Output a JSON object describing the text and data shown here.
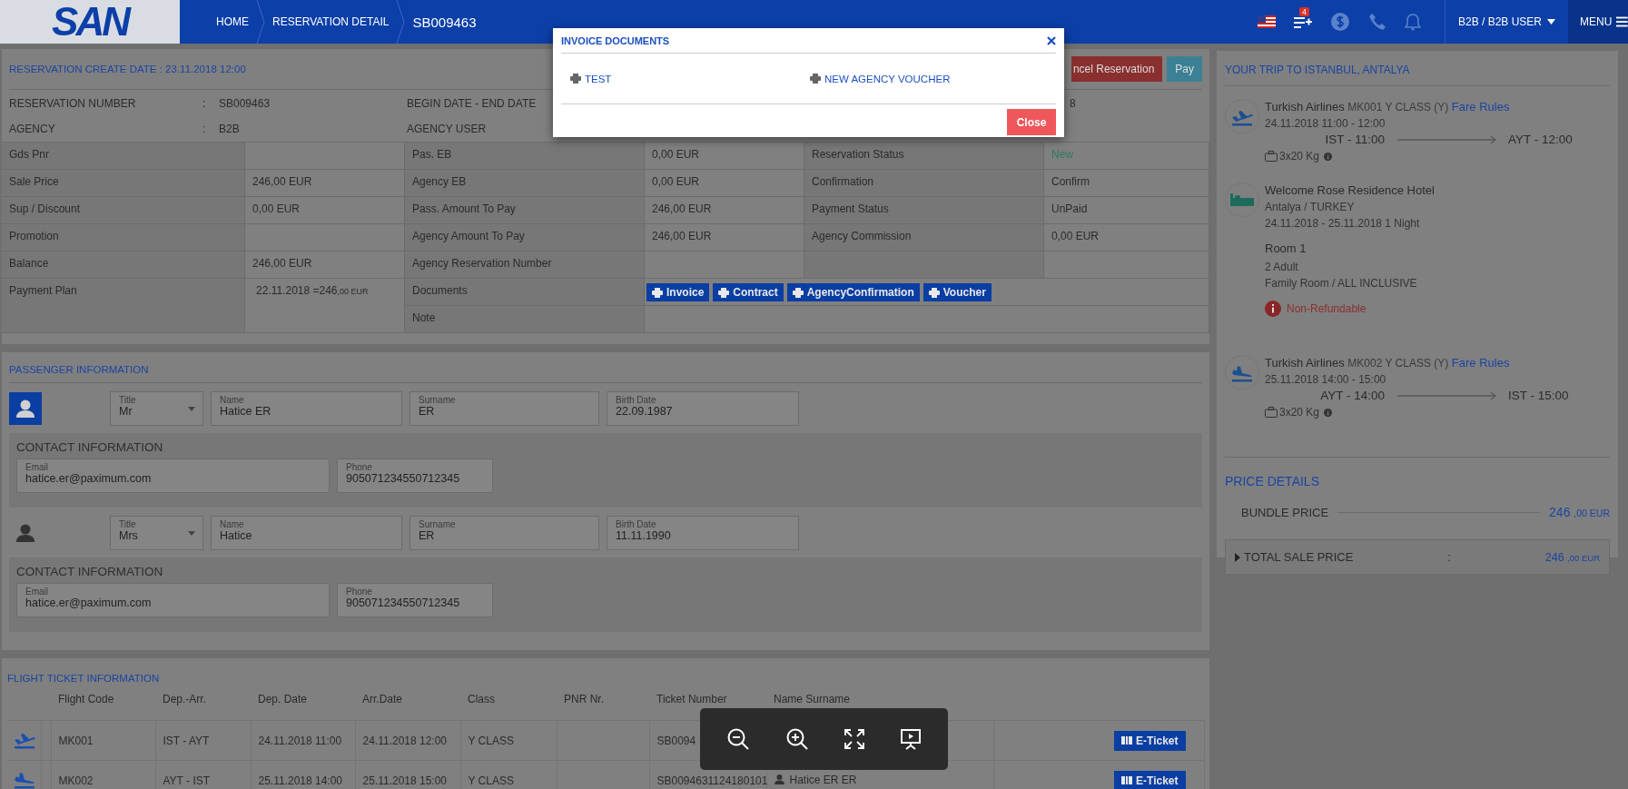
{
  "header": {
    "logo": "SAN",
    "breadcrumb": [
      {
        "label": "HOME",
        "current": false
      },
      {
        "label": "RESERVATION DETAIL",
        "current": false
      },
      {
        "label": "SB009463",
        "current": true
      }
    ],
    "cart_badge": "4",
    "user": "B2B / B2B USER",
    "menu": "MENU"
  },
  "reservation": {
    "title": "RESERVATION CREATE DATE : 23.11.2018 12:00",
    "actions": [
      {
        "label": "ncel Reservation",
        "kind": "danger"
      },
      {
        "label": "Pay",
        "kind": "primary"
      }
    ],
    "info": [
      {
        "label": "RESERVATION NUMBER",
        "separator": ":",
        "value": "SB009463"
      },
      {
        "label": "BEGIN DATE - END DATE",
        "value": "8"
      },
      {
        "label": "AGENCY",
        "separator": ":",
        "value": "B2B"
      },
      {
        "label": "AGENCY USER"
      }
    ],
    "grid": [
      {
        "cells": [
          {
            "kind": "label",
            "text": "Gds Pnr"
          },
          {
            "kind": "value"
          },
          {
            "kind": "label",
            "text": "Pas. EB"
          },
          {
            "kind": "value",
            "text": "0,00 EUR"
          },
          {
            "kind": "label",
            "text": "Reservation Status"
          },
          {
            "kind": "status",
            "text": "New"
          }
        ]
      },
      {
        "cells": [
          {
            "kind": "label",
            "text": "Sale Price"
          },
          {
            "kind": "value",
            "text": "246,00 EUR"
          },
          {
            "kind": "label",
            "text": "Agency EB"
          },
          {
            "kind": "value",
            "text": "0,00 EUR"
          },
          {
            "kind": "label",
            "text": "Confirmation"
          },
          {
            "kind": "value",
            "text": "Confirm"
          }
        ]
      },
      {
        "cells": [
          {
            "kind": "label",
            "text": "Sup / Discount"
          },
          {
            "kind": "value",
            "text": "0,00 EUR"
          },
          {
            "kind": "label",
            "text": "Pass. Amount To Pay"
          },
          {
            "kind": "value",
            "text": "246,00 EUR"
          },
          {
            "kind": "label",
            "text": "Payment Status"
          },
          {
            "kind": "value",
            "text": "UnPaid"
          }
        ]
      },
      {
        "cells": [
          {
            "kind": "label",
            "text": "Promotion"
          },
          {
            "kind": "value"
          },
          {
            "kind": "label",
            "text": "Agency Amount To Pay"
          },
          {
            "kind": "value",
            "text": "246,00 EUR"
          },
          {
            "kind": "label",
            "text": "Agency Commission"
          },
          {
            "kind": "value",
            "text": "0,00 EUR"
          }
        ]
      },
      {
        "cells": [
          {
            "kind": "label",
            "text": "Balance"
          },
          {
            "kind": "value",
            "text": "246,00 EUR"
          },
          {
            "kind": "label",
            "text": "Agency Reservation Number"
          },
          {
            "kind": "value"
          },
          {
            "kind": "label"
          },
          {
            "kind": "value"
          }
        ]
      }
    ],
    "payment_plan": {
      "label": "Payment Plan",
      "date_amount": "22.11.2018 =246",
      "decimals": ",00 EUR"
    },
    "documents": {
      "label": "Documents",
      "buttons": [
        {
          "label": "Invoice"
        },
        {
          "label": "Contract"
        },
        {
          "label": "AgencyConfirmation"
        },
        {
          "label": "Voucher"
        }
      ]
    },
    "note": {
      "label": "Note"
    }
  },
  "passengers": {
    "title": "PASSENGER INFORMATION",
    "items": [
      {
        "lead": true,
        "fields": [
          {
            "kind": "select",
            "label": "Title",
            "value": "Mr"
          },
          {
            "kind": "text",
            "label": "Name",
            "value": "Hatice ER"
          },
          {
            "kind": "text",
            "label": "Surname",
            "value": "ER"
          },
          {
            "kind": "text",
            "label": "Birth Date",
            "value": "22.09.1987"
          }
        ],
        "contact": {
          "title": "CONTACT INFORMATION",
          "fields": [
            {
              "kind": "email",
              "label": "Email",
              "value": "hatice.er@paximum.com"
            },
            {
              "kind": "phone",
              "label": "Phone",
              "value": "905071234550712345"
            }
          ]
        }
      },
      {
        "lead": false,
        "fields": [
          {
            "kind": "select",
            "label": "Title",
            "value": "Mrs"
          },
          {
            "kind": "text",
            "label": "Name",
            "value": "Hatice"
          },
          {
            "kind": "text",
            "label": "Surname",
            "value": "ER"
          },
          {
            "kind": "text",
            "label": "Birth Date",
            "value": "11.11.1990"
          }
        ],
        "contact": {
          "title": "CONTACT INFORMATION",
          "fields": [
            {
              "kind": "email",
              "label": "Email",
              "value": "hatice.er@paximum.com"
            },
            {
              "kind": "phone",
              "label": "Phone",
              "value": "905071234550712345"
            }
          ]
        }
      }
    ]
  },
  "tickets": {
    "title": "FLIGHT TICKET INFORMATION",
    "columns": [
      "Flight Code",
      "Dep.-Arr.",
      "Dep. Date",
      "Arr.Date",
      "Class",
      "PNR Nr.",
      "Ticket Number",
      "Name Surname"
    ],
    "rows": [
      {
        "kind": "departure",
        "flight_code": "MK001",
        "dep_arr": "IST - AYT",
        "dep_date": "24.11.2018 11:00",
        "arr_date": "24.11.2018 12:00",
        "class": "Y CLASS",
        "ticket_number": "SB0094",
        "button": "E-Ticket"
      },
      {
        "kind": "arrival",
        "flight_code": "MK002",
        "dep_arr": "AYT - IST",
        "dep_date": "25.11.2018 14:00",
        "arr_date": "25.11.2018 15:00",
        "class": "Y CLASS",
        "ticket_number": "SB0094631124180101",
        "name": "Hatice ER ER",
        "button": "E-Ticket"
      }
    ]
  },
  "trip": {
    "title": "YOUR TRIP TO ISTANBUL, ANTALYA",
    "items": [
      {
        "kind": "departure",
        "airline": "Turkish Airlines",
        "flight": "MK001 Y CLASS (Y)",
        "link": "Fare Rules",
        "time": "24.11.2018 11:00 - 12:00",
        "from": "IST - 11:00",
        "to": "AYT - 12:00",
        "baggage": "3x20 Kg"
      },
      {
        "kind": "hotel",
        "name": "Welcome Rose Residence Hotel",
        "location": "Antalya / TURKEY",
        "dates": "24.11.2018 - 25.11.2018 1 Night",
        "room": "Room 1",
        "guests": "2 Adult",
        "room_type": "Family Room / ALL INCLUSIVE",
        "refund": "Non-Refundable"
      },
      {
        "kind": "arrival",
        "airline": "Turkish Airlines",
        "flight": "MK002 Y CLASS (Y)",
        "link": "Fare Rules",
        "time": "25.11.2018 14:00 - 15:00",
        "from": "AYT - 14:00",
        "to": "IST - 15:00",
        "baggage": "3x20 Kg"
      }
    ],
    "price": {
      "title": "PRICE DETAILS",
      "rows": [
        {
          "kind": "line",
          "label": "BUNDLE PRICE",
          "amount": "246",
          "decimals": ",00 EUR"
        },
        {
          "kind": "total",
          "label": "TOTAL SALE PRICE",
          "separator": ":",
          "amount": "246",
          "decimals": ",00 EUR",
          "expanded": false
        }
      ]
    }
  },
  "modal": {
    "title": "INVOICE DOCUMENTS",
    "links": [
      {
        "label": "TEST"
      },
      {
        "label": "NEW AGENCY VOUCHER"
      }
    ],
    "button": "Close"
  }
}
